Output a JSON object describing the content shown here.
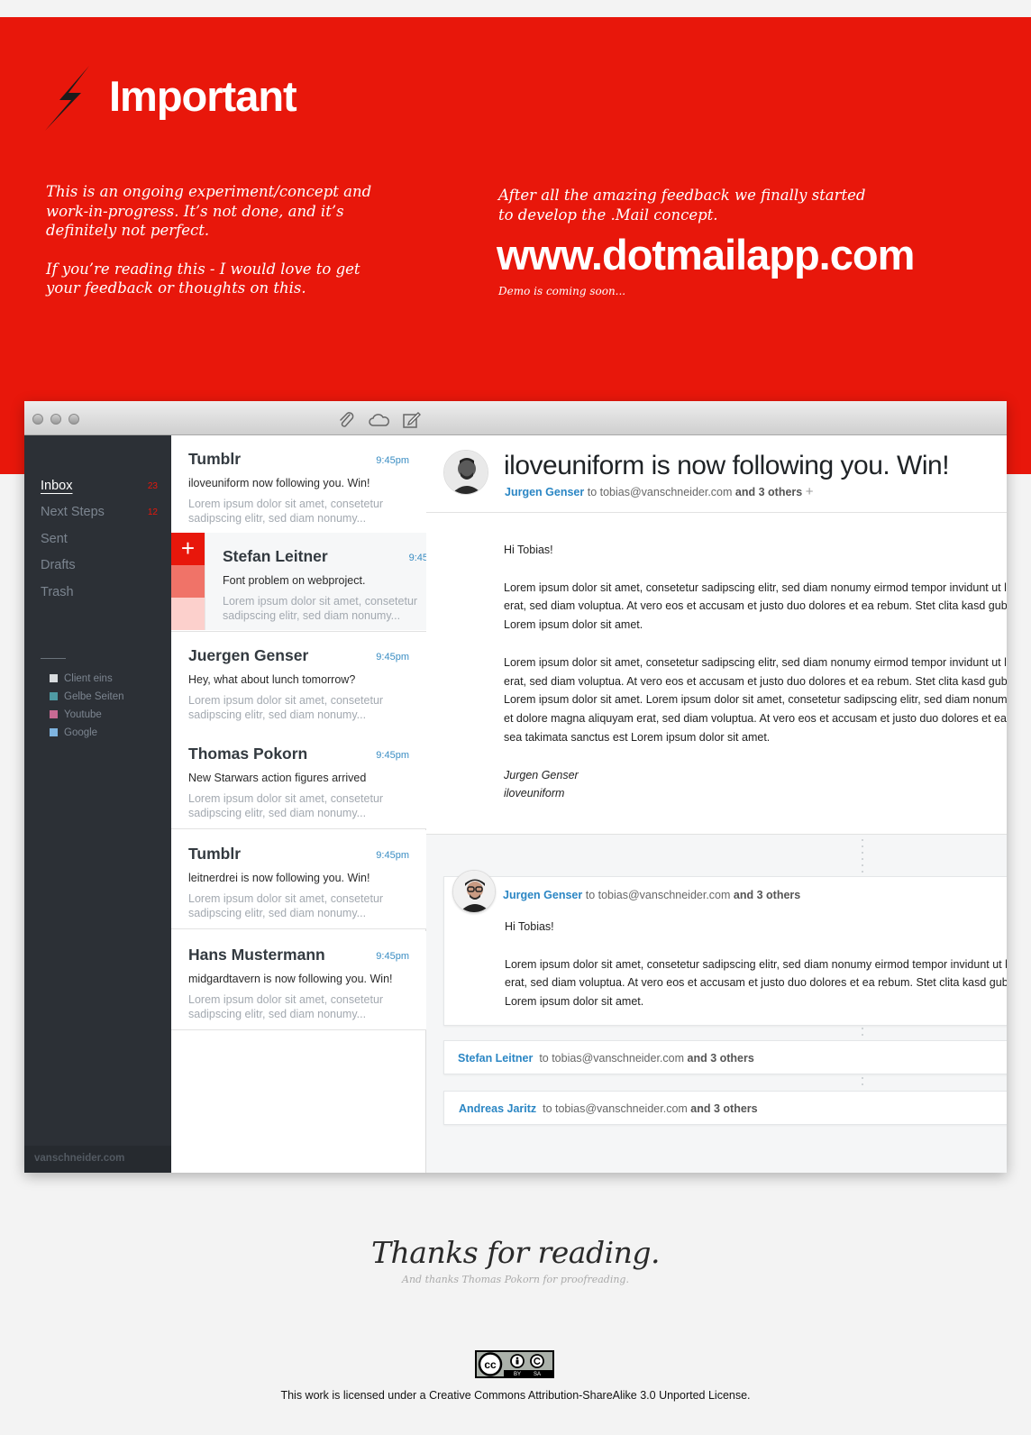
{
  "hero": {
    "title": "Important",
    "intro_left_1": "This is an ongoing experiment/concept and work-in-progress. It’s not done, and it’s definitely not perfect.",
    "intro_left_2": "If you’re reading this -  I would love to get your feedback or thoughts on this.",
    "intro_right": "After all the amazing feedback we finally started to develop the .Mail concept.",
    "url": "www.dotmailapp.com",
    "demo_note": "Demo is coming soon..."
  },
  "sidebar": {
    "items": [
      {
        "label": "Inbox",
        "count": "23"
      },
      {
        "label": "Next Steps",
        "count": "12"
      },
      {
        "label": "Sent",
        "count": ""
      },
      {
        "label": "Drafts",
        "count": ""
      },
      {
        "label": "Trash",
        "count": ""
      }
    ],
    "labels": [
      {
        "name": "Client eins",
        "color": "#d9dcdf"
      },
      {
        "name": "Gelbe Seiten",
        "color": "#4f9aa3"
      },
      {
        "name": "Youtube",
        "color": "#c86a93"
      },
      {
        "name": "Google",
        "color": "#7fb4e0"
      }
    ],
    "footer": "vanschneider.com"
  },
  "messages": [
    {
      "sender": "Tumblr",
      "time": "9:45pm",
      "subject": "iloveuniform now following you. Win!",
      "preview": "Lorem ipsum dolor sit amet, consetetur sadipscing elitr, sed diam nonumy..."
    },
    {
      "sender": "Stefan Leitner",
      "time": "9:45",
      "subject": "Font problem on webproject.",
      "preview": "Lorem ipsum dolor sit amet, consetetur sadipscing elitr, sed diam nonumy..."
    },
    {
      "sender": "Juergen Genser",
      "time": "9:45pm",
      "subject": "Hey, what about lunch tomorrow?",
      "preview": "Lorem ipsum dolor sit amet, consetetur sadipscing elitr, sed diam nonumy..."
    },
    {
      "sender": "Thomas Pokorn",
      "time": "9:45pm",
      "subject": "New Starwars action figures arrived",
      "preview": "Lorem ipsum dolor sit amet, consetetur sadipscing elitr, sed diam nonumy..."
    },
    {
      "sender": "Tumblr",
      "time": "9:45pm",
      "subject": "leitnerdrei is now following you. Win!",
      "preview": "Lorem ipsum dolor sit amet, consetetur sadipscing elitr, sed diam nonumy..."
    },
    {
      "sender": "Hans Mustermann",
      "time": "9:45pm",
      "subject": "midgardtavern is now following you. Win!",
      "preview": "Lorem ipsum dolor sit amet, consetetur sadipscing elitr, sed diam nonumy..."
    }
  ],
  "swipe_add_label": "+",
  "mail": {
    "title": "iloveuniform is now following you. Win!",
    "from": "Jurgen Genser",
    "to": "to tobias@vanschneider.com",
    "others": "and 3 others",
    "plus": "+",
    "greeting": "Hi Tobias!",
    "para1_l1": "Lorem ipsum dolor sit amet, consetetur sadipscing elitr, sed diam nonumy eirmod tempor invidunt ut labore et dolore magna aliquyam",
    "para1_l2": "erat, sed diam voluptua. At vero eos et accusam et justo duo dolores et ea rebum. Stet clita kasd gubergren, no sea takimata sanctus est",
    "para1_l3": "Lorem ipsum dolor sit amet.",
    "para2_l1": "Lorem ipsum dolor sit amet, consetetur sadipscing elitr, sed diam nonumy eirmod tempor invidunt ut labore et dolore magna aliquyam",
    "para2_l2": "erat, sed diam voluptua. At vero eos et accusam et justo duo dolores et ea rebum. Stet clita kasd gubergren, no sea takimata sanctus est",
    "para2_l3": "Lorem ipsum dolor sit amet. Lorem ipsum dolor sit amet, consetetur sadipscing elitr, sed diam nonumy eirmod tempor invidunt ut labore",
    "para2_l4": "et dolore magna aliquyam erat, sed diam voluptua. At vero eos et accusam et justo duo dolores et ea rebum. Stet clita kasd gubergren, no",
    "para2_l5": "sea takimata sanctus est Lorem ipsum dolor sit amet.",
    "sig_name": "Jurgen Genser",
    "sig_handle": "iloveuniform"
  },
  "reply": {
    "from": "Jurgen Genser",
    "to": "to tobias@vanschneider.com",
    "others": "and 3 others",
    "greeting": "Hi Tobias!",
    "l1": "Lorem ipsum dolor sit amet, consetetur sadipscing elitr, sed diam nonumy eirmod tempor invidunt ut labore et dolore magna aliquyam",
    "l2": "erat, sed diam voluptua. At vero eos et accusam et justo duo dolores et ea rebum. Stet clita kasd gubergren, no sea takimata sanctus est",
    "l3": "Lorem ipsum dolor sit amet."
  },
  "collapsed": [
    {
      "from": "Stefan Leitner",
      "to": "to tobias@vanschneider.com",
      "others": "and 3 others"
    },
    {
      "from": "Andreas Jaritz",
      "to": "to tobias@vanschneider.com",
      "others": "and 3 others"
    }
  ],
  "footer": {
    "thanks": "Thanks for reading.",
    "thanks_sub": "And thanks Thomas Pokorn for proofreading.",
    "cc_by": "BY",
    "cc_sa": "SA",
    "license": "This work is licensed under a Creative Commons Attribution-ShareAlike 3.0 Unported License."
  }
}
